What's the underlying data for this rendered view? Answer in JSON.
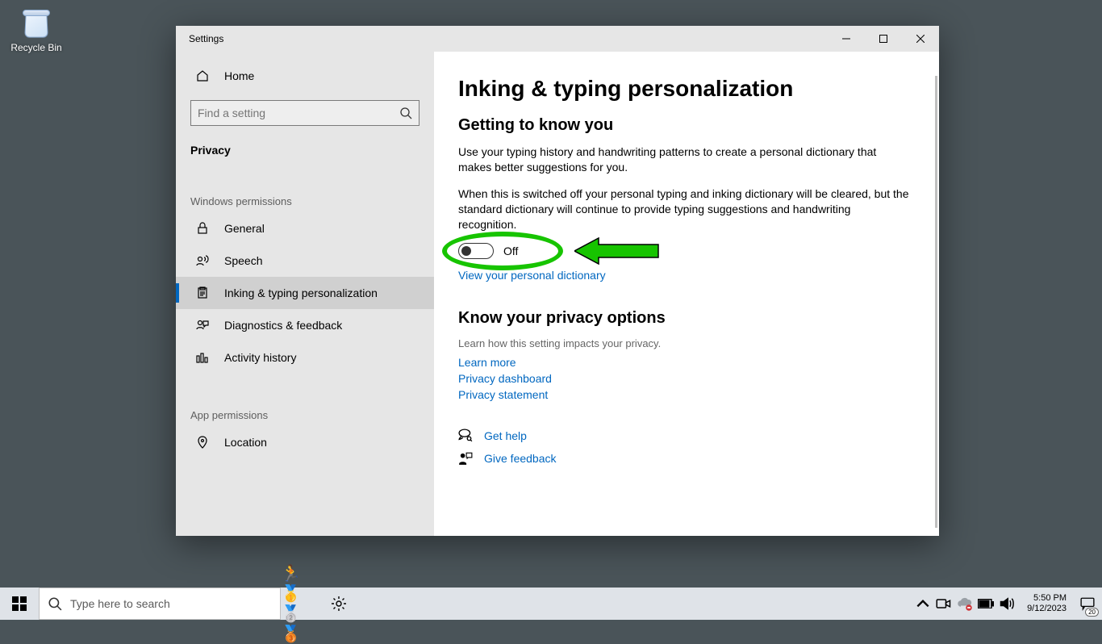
{
  "desktop": {
    "recycle_bin_label": "Recycle Bin"
  },
  "window": {
    "title": "Settings"
  },
  "sidebar": {
    "home": "Home",
    "search_placeholder": "Find a setting",
    "category": "Privacy",
    "group_windows": "Windows permissions",
    "items_win": [
      "General",
      "Speech",
      "Inking & typing personalization",
      "Diagnostics & feedback",
      "Activity history"
    ],
    "group_app": "App permissions",
    "items_app": [
      "Location"
    ]
  },
  "main": {
    "title": "Inking & typing personalization",
    "section1_heading": "Getting to know you",
    "section1_p1": "Use your typing history and handwriting patterns to create a personal dictionary that makes better suggestions for you.",
    "section1_p2": "When this is switched off your personal typing and inking dictionary will be cleared, but the standard dictionary will continue to provide typing suggestions and handwriting recognition.",
    "toggle_state": "Off",
    "view_dict_link": "View your personal dictionary",
    "section2_heading": "Know your privacy options",
    "section2_desc": "Learn how this setting impacts your privacy.",
    "links": [
      "Learn more",
      "Privacy dashboard",
      "Privacy statement"
    ],
    "get_help": "Get help",
    "give_feedback": "Give feedback"
  },
  "taskbar": {
    "search_placeholder": "Type here to search",
    "time": "5:50 PM",
    "date": "9/12/2023",
    "action_center_count": "20"
  }
}
